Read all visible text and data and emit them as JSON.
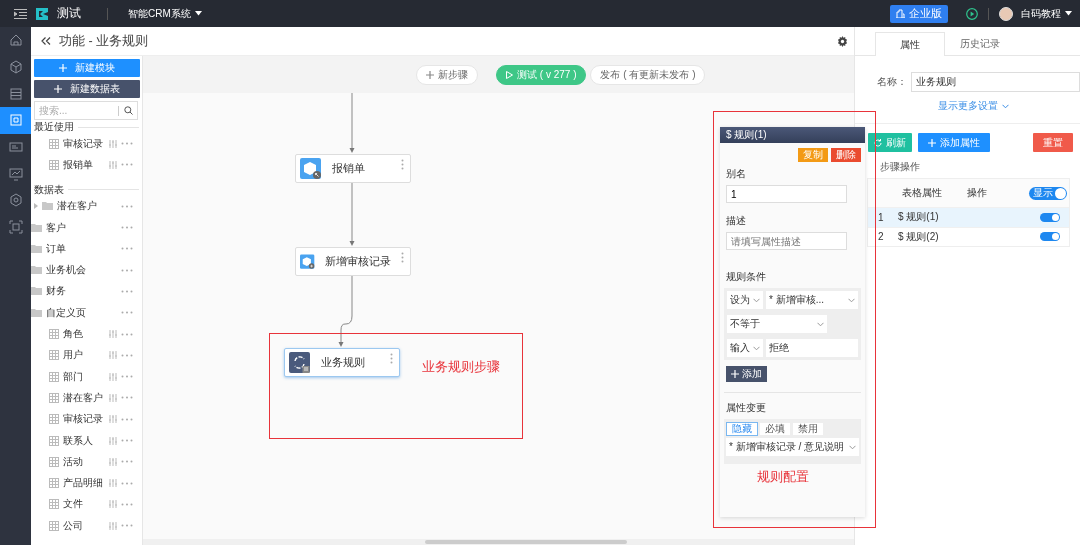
{
  "topbar": {
    "app_name": "测试",
    "system": "智能CRM系统",
    "edition_button": "企业版",
    "user": "白码教程"
  },
  "rail": [
    {
      "selected": false
    },
    {
      "selected": false
    },
    {
      "selected": false
    },
    {
      "selected": true
    },
    {
      "selected": false
    },
    {
      "selected": false
    },
    {
      "selected": false
    },
    {
      "selected": false
    }
  ],
  "header": {
    "title": "功能 - 业务规则"
  },
  "left_panel": {
    "new_module_button": "新建模块",
    "new_table_button": "新建数据表",
    "search": {
      "placeholder": "搜索..."
    },
    "recent": {
      "heading": "最近使用",
      "items": [
        {
          "label": "审核记录"
        },
        {
          "label": "报销单"
        }
      ]
    },
    "tables": {
      "heading": "数据表",
      "items": [
        {
          "label": "潜在客户",
          "kind": "group"
        },
        {
          "label": "客户",
          "kind": "folder"
        },
        {
          "label": "订单",
          "kind": "folder"
        },
        {
          "label": "业务机会",
          "kind": "folder"
        },
        {
          "label": "财务",
          "kind": "folder"
        },
        {
          "label": "自定义页",
          "kind": "folder",
          "children": [
            {
              "label": "角色"
            },
            {
              "label": "用户"
            },
            {
              "label": "部门"
            },
            {
              "label": "潜在客户"
            },
            {
              "label": "审核记录"
            },
            {
              "label": "联系人"
            },
            {
              "label": "活动"
            },
            {
              "label": "产品明细"
            },
            {
              "label": "文件"
            },
            {
              "label": "公司"
            }
          ]
        }
      ]
    }
  },
  "canvas": {
    "toolbar": {
      "new_step": "新步骤",
      "test": "测试 ( v 277 )",
      "publish": "发布 ( 有更新未发布 )"
    },
    "nodes": [
      {
        "label": "报销单",
        "kind": "data",
        "selected": false
      },
      {
        "label": "新增审核记录",
        "kind": "add",
        "selected": false
      },
      {
        "label": "业务规则",
        "kind": "rule",
        "selected": true
      }
    ]
  },
  "rule_panel": {
    "title": "$ 规则(1)",
    "copy_button": "复制",
    "delete_button": "删除",
    "alias_label": "别名",
    "alias_value": "1",
    "desc_label": "描述",
    "desc_placeholder": "请填写属性描述",
    "conditions_label": "规则条件",
    "condition_rows": [
      {
        "fields": [
          {
            "kind": "select",
            "value": "设为"
          },
          {
            "kind": "select",
            "value": "* 新增审核..."
          }
        ]
      },
      {
        "fields": [
          {
            "kind": "select",
            "value": "不等于"
          }
        ]
      },
      {
        "fields": [
          {
            "kind": "select",
            "value": "输入"
          },
          {
            "kind": "input",
            "value": "拒绝"
          }
        ]
      }
    ],
    "add_button": "添加",
    "change_label": "属性变更",
    "change_tabs": [
      {
        "label": "隐藏",
        "selected": true
      },
      {
        "label": "必填",
        "selected": false
      },
      {
        "label": "禁用",
        "selected": false
      }
    ],
    "change_field": "* 新增审核记录 / 意见说明"
  },
  "annotations": [
    {
      "text": "业务规则步骤"
    },
    {
      "text": "规则配置"
    }
  ],
  "right_panel": {
    "tabs": [
      {
        "label": "属性",
        "selected": true
      },
      {
        "label": "历史记录",
        "selected": false
      }
    ],
    "name_label": "名称：",
    "name_value": "业务规则",
    "more_link": "显示更多设置",
    "refresh_button": "刷新",
    "add_attr_button": "添加属性",
    "reset_button": "重置",
    "section": "步骤操作",
    "columns": [
      "表格属性",
      "操作"
    ],
    "header_toggle": {
      "label": "显示",
      "on": true
    },
    "rows": [
      {
        "index": "1",
        "name": "$ 规则(1)",
        "selected": true,
        "on": true
      },
      {
        "index": "2",
        "name": "$ 规则(2)",
        "selected": false,
        "on": true
      }
    ]
  }
}
